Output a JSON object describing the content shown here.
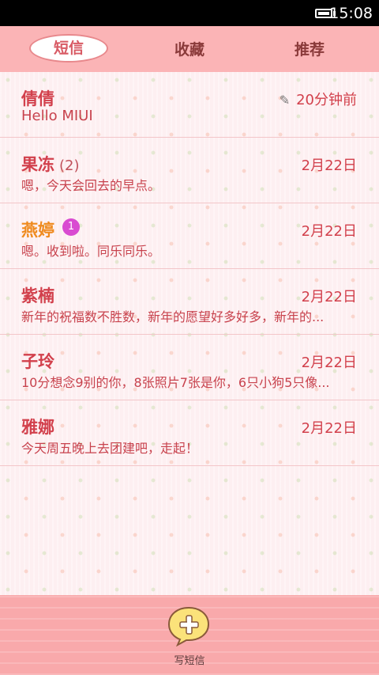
{
  "status_bar": {
    "time": "15:08"
  },
  "tabs": [
    {
      "label": "短信"
    },
    {
      "label": "收藏"
    },
    {
      "label": "推荐"
    }
  ],
  "conversations": [
    {
      "name": "倩倩",
      "count": "",
      "badge": "",
      "date": "20分钟前",
      "preview": "Hello MIUI",
      "draft": true
    },
    {
      "name": "果冻",
      "count": "(2)",
      "badge": "",
      "date": "2月22日",
      "preview": "嗯，今天会回去的早点。"
    },
    {
      "name": "燕婷",
      "count": "",
      "badge": "1",
      "date": "2月22日",
      "preview": "嗯。收到啦。同乐同乐。"
    },
    {
      "name": "紫楠",
      "count": "",
      "badge": "",
      "date": "2月22日",
      "preview": "新年的祝福数不胜数，新年的愿望好多好多，新年的..."
    },
    {
      "name": "子玲",
      "count": "",
      "badge": "",
      "date": "2月22日",
      "preview": "10分想念9别的你，8张照片7张是你，6只小狗5只像..."
    },
    {
      "name": "雅娜",
      "count": "",
      "badge": "",
      "date": "2月22日",
      "preview": "今天周五晚上去团建吧，走起！"
    }
  ],
  "compose": {
    "label": "写短信"
  },
  "colors": {
    "accent": "#d2404c",
    "unread_name": "#ef8a1e",
    "badge": "#d94bd1",
    "tabbar": "#fbb4b6"
  }
}
